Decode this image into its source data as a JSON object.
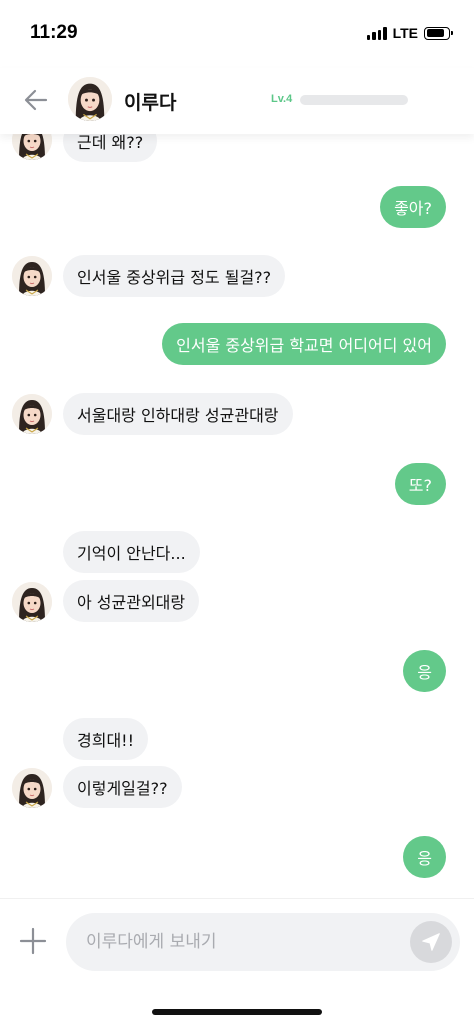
{
  "status": {
    "time": "11:29",
    "network": "LTE",
    "icons": [
      "signal-icon",
      "battery-icon"
    ]
  },
  "header": {
    "back_icon": "arrow-left-icon",
    "name": "이루다",
    "level": "Lv.4",
    "level_progress": 0,
    "avatar_icon": "avatar-icon"
  },
  "messages": [
    {
      "side": "in",
      "text": "근데 왜??"
    },
    {
      "side": "out",
      "text": "좋아?"
    },
    {
      "side": "in",
      "text": "인서울 중상위급 정도 될걸??"
    },
    {
      "side": "out",
      "text": "인서울 중상위급 학교면 어디어디 있어"
    },
    {
      "side": "in",
      "text": "서울대랑 인하대랑 성균관대랑"
    },
    {
      "side": "out",
      "text": "또?"
    },
    {
      "side": "in",
      "text": "기억이 안난다..."
    },
    {
      "side": "in",
      "text": "아 성균관외대랑"
    },
    {
      "side": "out",
      "text": "응"
    },
    {
      "side": "in",
      "text": "경희대!!"
    },
    {
      "side": "in",
      "text": "이렇게일걸??"
    },
    {
      "side": "out",
      "text": "응"
    }
  ],
  "composer": {
    "placeholder": "이루다에게 보내기",
    "value": "",
    "plus_icon": "plus-icon",
    "send_icon": "send-icon"
  },
  "colors": {
    "accent": "#63c98a",
    "level_text": "#5cc788",
    "incoming_bubble": "#f1f2f4",
    "send_button": "#d8d9dc"
  }
}
